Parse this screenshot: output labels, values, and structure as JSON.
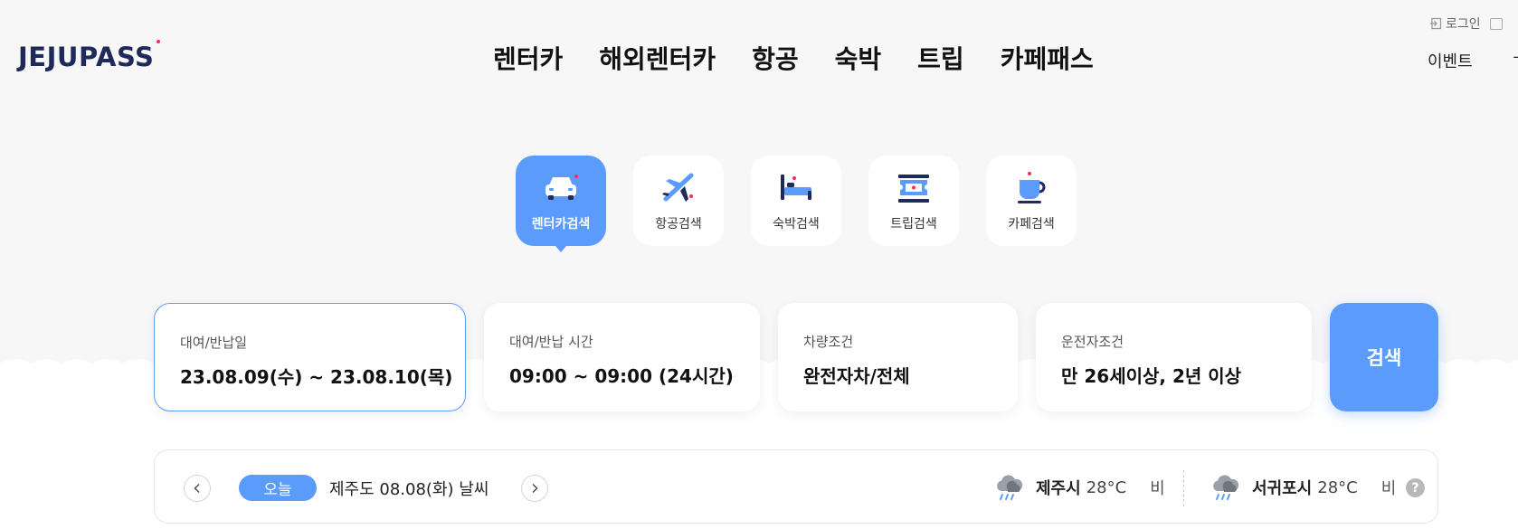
{
  "header": {
    "logo": "JEJUPASS",
    "nav": [
      "렌터카",
      "해외렌터카",
      "항공",
      "숙박",
      "트립",
      "카페패스"
    ],
    "login": "로그인",
    "event": "이벤트",
    "next_truncated": "ㄱ"
  },
  "tabs": [
    {
      "label": "렌터카검색",
      "icon": "car-icon",
      "active": true
    },
    {
      "label": "항공검색",
      "icon": "airplane-icon",
      "active": false
    },
    {
      "label": "숙박검색",
      "icon": "bed-icon",
      "active": false
    },
    {
      "label": "트립검색",
      "icon": "ticket-icon",
      "active": false
    },
    {
      "label": "카페검색",
      "icon": "coffee-cup-icon",
      "active": false
    }
  ],
  "search": {
    "dates": {
      "label": "대여/반납일",
      "value": "23.08.09(수) ~ 23.08.10(목)"
    },
    "time": {
      "label": "대여/반납 시간",
      "value": "09:00 ~ 09:00 (24시간)"
    },
    "vehicle": {
      "label": "차량조건",
      "value": "완전자차/전체"
    },
    "driver": {
      "label": "운전자조건",
      "value": "만 26세이상, 2년 이상"
    },
    "button": "검색"
  },
  "weather": {
    "today": "오늘",
    "title": "제주도 08.08(화) 날씨",
    "cities": [
      {
        "name": "제주시",
        "temp": "28°C",
        "condition": "비",
        "icon": "rain-cloud-icon"
      },
      {
        "name": "서귀포시",
        "temp": "28°C",
        "condition": "비",
        "icon": "rain-cloud-icon"
      }
    ],
    "help": "?"
  },
  "colors": {
    "accent": "#5b9bfc",
    "logo_navy": "#1e2a5a",
    "logo_dot": "#ff2a5a",
    "icon_pink": "#ff2a5a",
    "background": "#f7f7f8"
  }
}
